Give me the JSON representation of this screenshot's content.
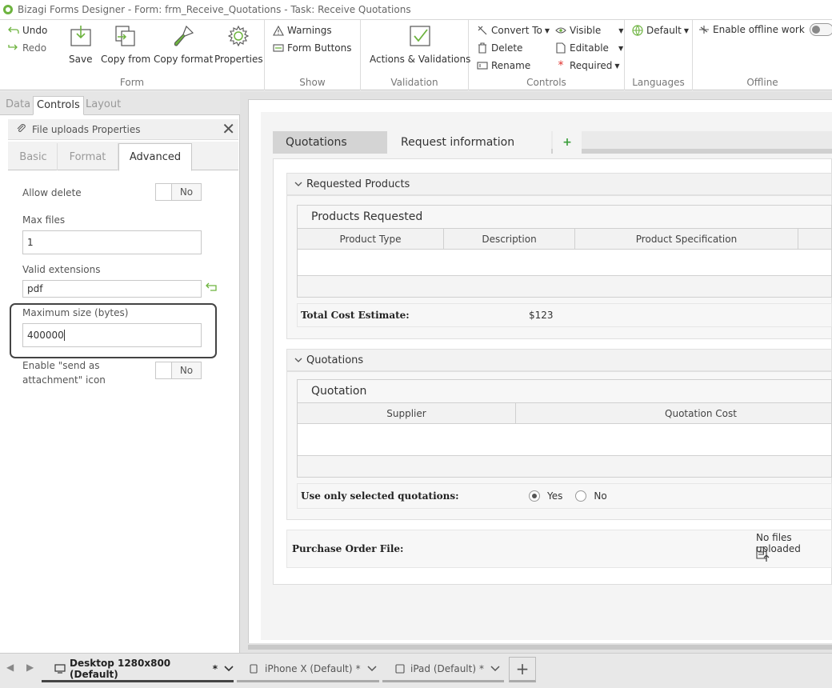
{
  "window": {
    "title": "Bizagi Forms Designer   - Form: frm_Receive_Quotations - Task:  Receive Quotations"
  },
  "ribbon": {
    "form": {
      "label": "Form",
      "undo": "Undo",
      "redo": "Redo",
      "save": "Save",
      "copy_from": "Copy from",
      "copy_format": "Copy format",
      "properties": "Properties"
    },
    "show": {
      "label": "Show",
      "warnings": "Warnings",
      "form_buttons": "Form Buttons"
    },
    "validation": {
      "label": "Validation",
      "actions": "Actions & Validations"
    },
    "controls": {
      "label": "Controls",
      "convert_to": "Convert To",
      "delete": "Delete",
      "rename": "Rename",
      "visible": "Visible",
      "editable": "Editable",
      "required": "Required"
    },
    "languages": {
      "label": "Languages",
      "default": "Default"
    },
    "offline": {
      "label": "Offline",
      "enable": "Enable offline work"
    }
  },
  "left_panel": {
    "tabs": [
      "Data",
      "Controls",
      "Layout"
    ],
    "properties_title": "File uploads Properties",
    "subtabs": [
      "Basic",
      "Format",
      "Advanced"
    ],
    "allow_delete": {
      "label": "Allow delete",
      "value": "No"
    },
    "max_files": {
      "label": "Max files",
      "value": "1"
    },
    "valid_extensions": {
      "label": "Valid extensions",
      "value": "pdf"
    },
    "max_size": {
      "label": "Maximum size (bytes)",
      "value": "400000"
    },
    "send_attachment": {
      "label_line1": "Enable \"send as",
      "label_line2": "attachment\" icon",
      "value": "No"
    }
  },
  "form": {
    "tabs": [
      "Quotations",
      "Request information"
    ],
    "add_tab": "+",
    "requested_products": {
      "title": "Requested Products",
      "grid_title": "Products Requested",
      "columns": [
        "Product Type",
        "Description",
        "Product Specification"
      ],
      "total_label": "Total Cost Estimate:",
      "total_value": "$123"
    },
    "quotations": {
      "title": "Quotations",
      "grid_title": "Quotation",
      "columns": [
        "Supplier",
        "Quotation Cost"
      ],
      "use_selected_label": "Use only selected quotations:",
      "yes": "Yes",
      "no": "No"
    },
    "purchase_order": {
      "label": "Purchase Order File:",
      "status": "No files uploaded"
    }
  },
  "bottom": {
    "devices": [
      {
        "label": "Desktop 1280x800 (Default)",
        "mark": "*"
      },
      {
        "label": "iPhone X (Default)",
        "mark": "*"
      },
      {
        "label": "iPad (Default)",
        "mark": "*"
      }
    ],
    "add": "+"
  },
  "colors": {
    "accent_green": "#6db33f",
    "add_green": "#3a9e3a"
  }
}
